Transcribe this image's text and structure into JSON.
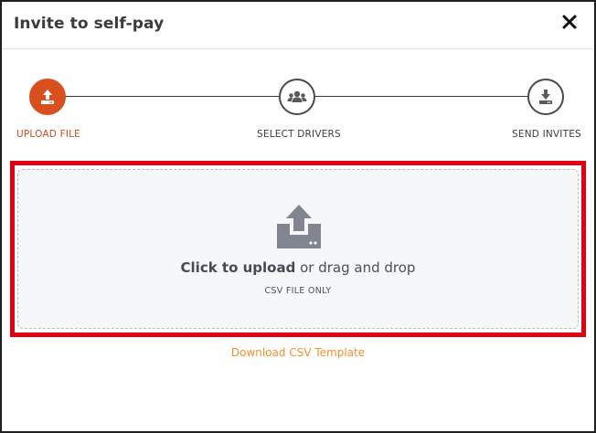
{
  "modal": {
    "title": "Invite to self-pay",
    "close_icon": "close-icon"
  },
  "stepper": {
    "steps": [
      {
        "label": "UPLOAD FILE",
        "icon": "upload-icon",
        "state": "active"
      },
      {
        "label": "SELECT DRIVERS",
        "icon": "users-icon",
        "state": "inactive"
      },
      {
        "label": "SEND INVITES",
        "icon": "download-icon",
        "state": "inactive"
      }
    ]
  },
  "dropzone": {
    "icon": "upload-tray-icon",
    "click_text": "Click to upload",
    "drag_text": " or drag and drop",
    "hint": "CSV FILE ONLY"
  },
  "template_link": "Download CSV Template",
  "colors": {
    "accent": "#d9501f",
    "link": "#f0922e",
    "highlight": "#e3000f",
    "text": "#4b4f58"
  }
}
